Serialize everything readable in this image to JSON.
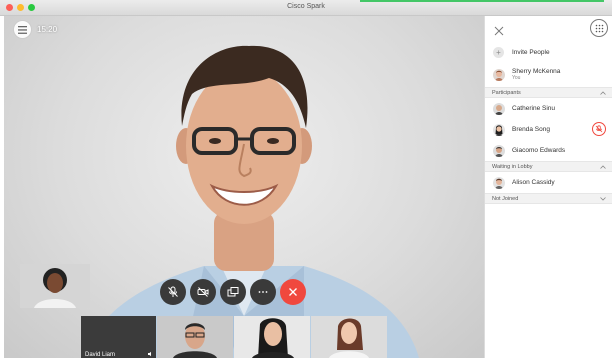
{
  "window": {
    "title": "Cisco Spark",
    "colors": {
      "close": "#fd5f57",
      "minimize": "#febb2e",
      "zoom": "#29c940",
      "progress": "#44c767"
    }
  },
  "call": {
    "time": "15:20",
    "controls": [
      "mute-icon",
      "video-icon",
      "share-screen-icon",
      "more-icon",
      "end-call-icon"
    ],
    "end_color": "#f0483e"
  },
  "thumbnails": [
    {
      "label": "David Liam"
    }
  ],
  "panel": {
    "invite_label": "Invite People",
    "me": {
      "name": "Sherry McKenna",
      "sub": "You"
    },
    "sections": {
      "participants": "Participants",
      "waiting": "Waiting in Lobby",
      "not_joined": "Not Joined"
    },
    "participants": [
      {
        "name": "Catherine Sinu"
      },
      {
        "name": "Brenda Song"
      },
      {
        "name": "Giacomo Edwards"
      }
    ],
    "lobby": [
      {
        "name": "Alison Cassidy"
      }
    ]
  }
}
